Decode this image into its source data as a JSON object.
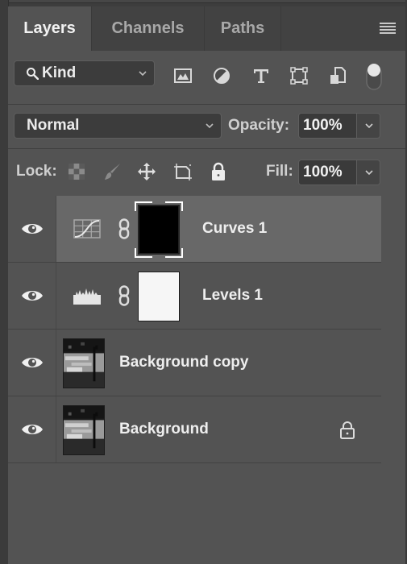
{
  "panel": {
    "tabs": [
      {
        "label": "Layers",
        "active": true
      },
      {
        "label": "Channels",
        "active": false
      },
      {
        "label": "Paths",
        "active": false
      }
    ],
    "menu_icon": "hamburger-menu-icon"
  },
  "filter": {
    "kind_label": "Kind",
    "filter_icons": [
      "pixel-layer-filter-icon",
      "adjustment-layer-filter-icon",
      "type-layer-filter-icon",
      "shape-layer-filter-icon",
      "smart-object-filter-icon"
    ],
    "filter_toggle_on": true
  },
  "blend": {
    "mode": "Normal",
    "opacity_label": "Opacity:",
    "opacity_value": "100%"
  },
  "lock": {
    "label": "Lock:",
    "icons": [
      "lock-transparent-pixels-icon",
      "lock-image-pixels-icon",
      "lock-position-icon",
      "lock-artboard-icon",
      "lock-all-icon"
    ],
    "fill_label": "Fill:",
    "fill_value": "100%"
  },
  "layers": [
    {
      "name": "Curves 1",
      "type": "adjustment",
      "adjustment": "curves",
      "mask": "black",
      "visible": true,
      "selected": true,
      "locked": false
    },
    {
      "name": "Levels 1",
      "type": "adjustment",
      "adjustment": "levels",
      "mask": "white",
      "visible": true,
      "selected": false,
      "locked": false
    },
    {
      "name": "Background copy",
      "type": "pixel",
      "visible": true,
      "selected": false,
      "locked": false
    },
    {
      "name": "Background",
      "type": "pixel",
      "visible": true,
      "selected": false,
      "locked": true
    }
  ]
}
